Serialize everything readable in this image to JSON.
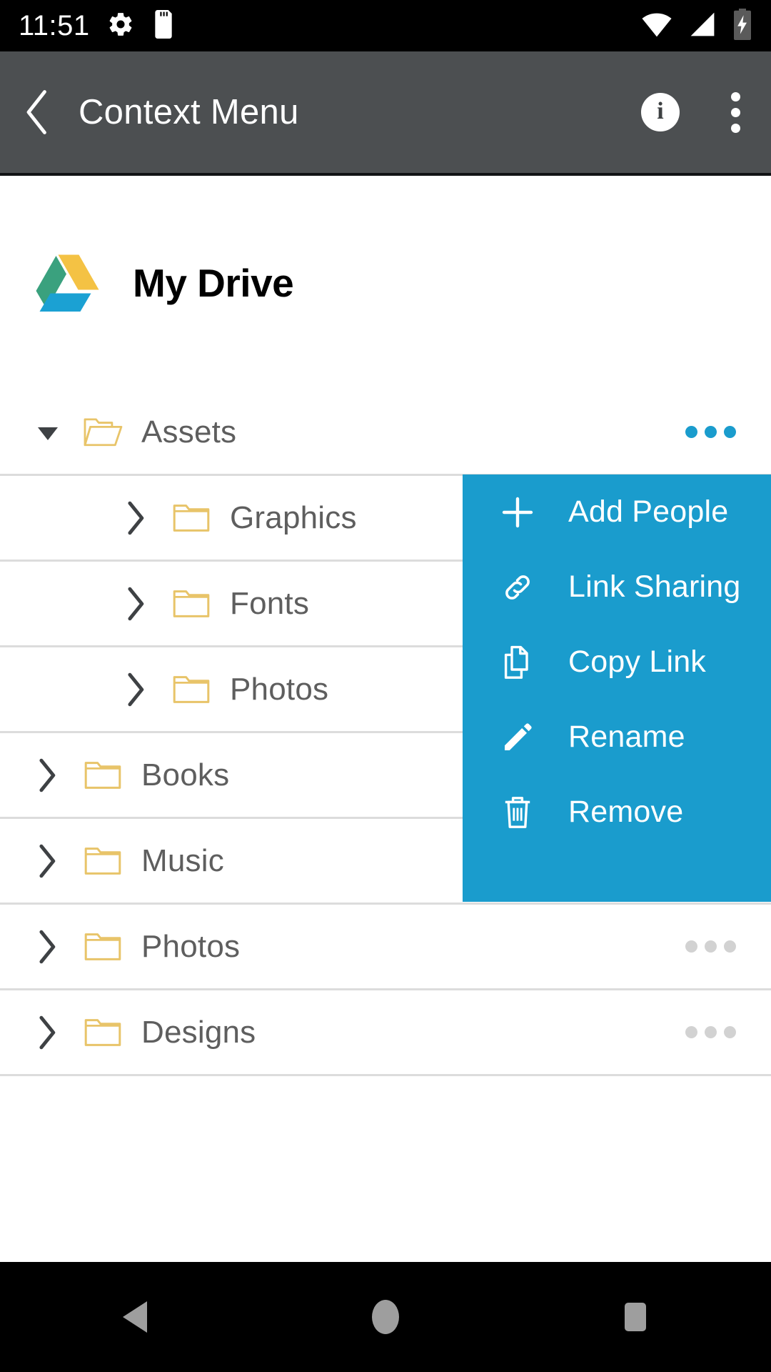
{
  "status_bar": {
    "time": "11:51",
    "left_icons": [
      {
        "name": "settings-gear-icon"
      },
      {
        "name": "sd-card-icon"
      }
    ],
    "right_icons": [
      {
        "name": "wifi-icon"
      },
      {
        "name": "cellular-signal-icon"
      },
      {
        "name": "battery-charging-icon"
      }
    ]
  },
  "app_bar": {
    "back_label": "‹",
    "title": "Context Menu",
    "info_glyph": "i",
    "info_label": "Info",
    "overflow_label": "More options",
    "background": "#4c4f51"
  },
  "drive_header": {
    "logo_name": "google-drive-logo",
    "title": "My Drive",
    "logo_colors": {
      "green": "#3aa17e",
      "yellow": "#f4c244",
      "blue": "#1ba1d3"
    }
  },
  "tree": {
    "rows": [
      {
        "label": "Assets",
        "level": 0,
        "expanded": true,
        "twisty": "caret-down-icon",
        "folder": "folder-open-icon",
        "overflow": "blue",
        "rule": true
      },
      {
        "label": "Graphics",
        "level": 1,
        "expanded": false,
        "twisty": "chevron-right-icon",
        "folder": "folder-closed-icon",
        "overflow": "none",
        "rule": true
      },
      {
        "label": "Fonts",
        "level": 1,
        "expanded": false,
        "twisty": "chevron-right-icon",
        "folder": "folder-closed-icon",
        "overflow": "none",
        "rule": true
      },
      {
        "label": "Photos",
        "level": 1,
        "expanded": false,
        "twisty": "chevron-right-icon",
        "folder": "folder-closed-icon",
        "overflow": "none",
        "rule": true
      },
      {
        "label": "Books",
        "level": 0,
        "expanded": false,
        "twisty": "chevron-right-icon",
        "folder": "folder-closed-icon",
        "overflow": "none",
        "rule": true
      },
      {
        "label": "Music",
        "level": 0,
        "expanded": false,
        "twisty": "chevron-right-icon",
        "folder": "folder-closed-icon",
        "overflow": "none",
        "rule": true
      },
      {
        "label": "Photos",
        "level": 0,
        "expanded": false,
        "twisty": "chevron-right-icon",
        "folder": "folder-closed-icon",
        "overflow": "grey",
        "rule": true
      },
      {
        "label": "Designs",
        "level": 0,
        "expanded": false,
        "twisty": "chevron-right-icon",
        "folder": "folder-closed-icon",
        "overflow": "grey",
        "rule": true
      }
    ]
  },
  "context_menu": {
    "background": "#1a9ccd",
    "items": [
      {
        "label": "Add People",
        "icon": "plus-icon"
      },
      {
        "label": "Link Sharing",
        "icon": "link-chain-icon"
      },
      {
        "label": "Copy Link",
        "icon": "copy-icon"
      },
      {
        "label": "Rename",
        "icon": "pencil-icon"
      },
      {
        "label": "Remove",
        "icon": "trash-icon"
      }
    ]
  },
  "nav_bar": {
    "buttons": [
      {
        "name": "nav-back-button",
        "label": "Back"
      },
      {
        "name": "nav-home-button",
        "label": "Home"
      },
      {
        "name": "nav-recents-button",
        "label": "Recents"
      }
    ],
    "icon_color": "#9e9e9e"
  },
  "colors": {
    "folder_outline": "#e8c469",
    "row_text": "#5e5e5e",
    "divider": "#dcdcdc",
    "accent_blue": "#1a9ccd"
  }
}
